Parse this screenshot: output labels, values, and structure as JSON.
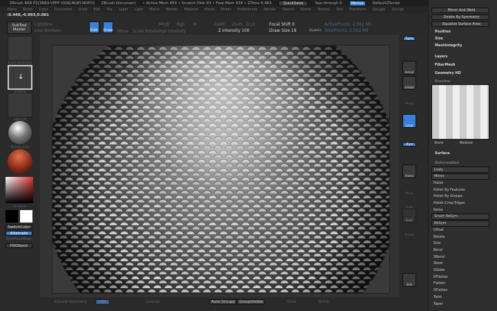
{
  "title": {
    "app": "ZBrush 4R8 P2[3B83-VPPF-QQKJ-BUEI-NOFU]",
    "doc": "ZBrush Document",
    "status": "• Active Mem 954 • Scratch Disk 83 • Free Mem 434 • ZTime 6.463",
    "quicksave": "QuickSave",
    "seethrough": "See-through 0",
    "menus": "Menus",
    "script": "DefaultZScript"
  },
  "menu": [
    "Alpha",
    "Brush",
    "Color",
    "Document",
    "Draw",
    "Edit",
    "File",
    "Layer",
    "Light",
    "Macro",
    "Marker",
    "Material",
    "Movie",
    "Picker",
    "Preferences",
    "Render",
    "Stencil",
    "Stroke",
    "Texture",
    "Tool",
    "Transform",
    "Zplugin",
    "Zscript"
  ],
  "coord": "-0.448,-0.993,0.081",
  "toolbar": {
    "subtool": "SubTool Master",
    "lightbox": "LightBox",
    "liveboolean": "Live Boolean",
    "edit": "Edit",
    "draw": "Draw",
    "move": "Move",
    "scale": "Scale",
    "rotate": "Rotate",
    "mrgb": "Mrgb",
    "rgb": "Rgb",
    "m": "M",
    "zadd": "Zadd",
    "zsub": "Zsub",
    "zcut": "Zcut",
    "rgb_intensity": "Rgb Intensity",
    "z_intensity": "Z Intensity 100",
    "focal_shift": "Focal Shift 0",
    "draw_size": "Draw Size 19",
    "dynamic": "Dynamic",
    "active_points": "ActivePoints: 2.562 Mil",
    "total_points": "TotalPoints: 2.562 Mil"
  },
  "left": {
    "captions": [
      "Insert_Multimesh",
      "Gradient",
      "Alpha Off",
      "MatCap_Gray",
      "Gradient"
    ],
    "switch_color": "SwitchColor",
    "alternate": "Alternate",
    "back_face": "BackFaceMask",
    "fill_object": "FillObject"
  },
  "tray": {
    "spix": "Spix",
    "actual": "Actual",
    "aahalf": "AAHalf",
    "persp": "Persp",
    "floor": "Floor",
    "local": "Local",
    "xyz": "Xyz",
    "frame": "Frame",
    "move": "Move",
    "scale": "Scale",
    "rotate": "Rotate",
    "polyf": "PolyF",
    "transp": "Transp",
    "solo": "Solo"
  },
  "right": {
    "top": [
      "Mirror And Weld",
      "Delete By Symmetry",
      "Equalize Surface Area",
      "Position",
      "Size",
      "MeshIntegrity"
    ],
    "sections": [
      "Layers",
      "FiberMesh",
      "Geometry HD"
    ],
    "preview": "Preview",
    "store": "Store",
    "restore": "Restore",
    "surface": "Surface",
    "deformation": "Deformation",
    "def_items": [
      "Unify",
      "Mirror",
      "Polish",
      "Polish By Features",
      "Polish By Groups",
      "Polish Crisp Edges",
      "Relax",
      "Smart ReSym",
      "ReSym",
      "Offset",
      "Rotate",
      "Size",
      "Bend",
      "SBend",
      "Skew",
      "SSkew",
      "RFlatten",
      "Flatten",
      "SFlatten",
      "Twist",
      "Taper"
    ]
  },
  "bottom": {
    "activate_symmetry": "Activate Symmetry",
    ">X<": ">X<",
    "colorize": "Colorize",
    "auto_groups": "Auto Groups",
    "group_visible": "GroupVisible",
    "grow": "Grow",
    "shrink": "Shrink"
  }
}
